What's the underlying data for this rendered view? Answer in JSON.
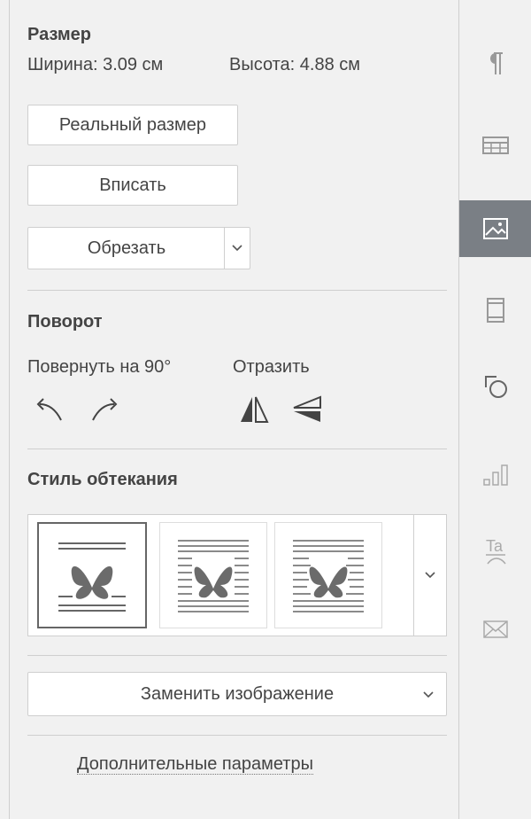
{
  "size": {
    "title": "Размер",
    "width_label": "Ширина: 3.09 см",
    "height_label": "Высота: 4.88 см",
    "actual_size_button": "Реальный размер",
    "fit_button": "Вписать",
    "crop_button": "Обрезать"
  },
  "rotation": {
    "title": "Поворот",
    "rotate_label": "Повернуть на 90°",
    "flip_label": "Отразить"
  },
  "wrapping": {
    "title": "Стиль обтекания",
    "selected_index": 0
  },
  "replace_image": {
    "label": "Заменить изображение"
  },
  "advanced": {
    "label": "Дополнительные параметры"
  },
  "rightbar": {
    "active": "image-settings",
    "items": [
      "paragraph-icon",
      "table-icon",
      "image-icon",
      "header-footer-icon",
      "shape-icon",
      "chart-icon",
      "text-art-icon",
      "mail-merge-icon"
    ]
  },
  "colors": {
    "active_tab_bg": "#7a7f85",
    "panel_bg": "#f1f1f1",
    "border": "#cfcfcf",
    "text": "#444444"
  }
}
